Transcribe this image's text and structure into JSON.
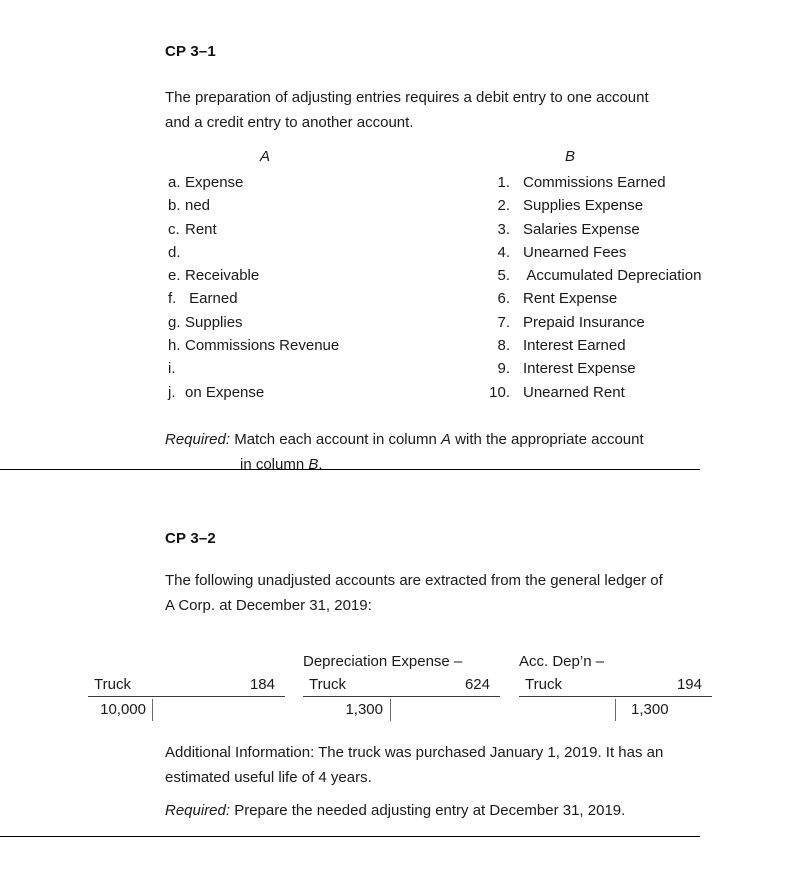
{
  "document": {
    "problems": [
      {
        "id": "cp-3-1",
        "title": "CP 3–1",
        "intro": "The preparation of adjusting entries requires a debit entry to one account and a credit entry to another account.",
        "column_a_header": "A",
        "column_b_header": "B",
        "column_a": [
          {
            "marker": "a.",
            "label": "Expense"
          },
          {
            "marker": "b.",
            "label": "ned"
          },
          {
            "marker": "c.",
            "label": "Rent"
          },
          {
            "marker": "d.",
            "label": ""
          },
          {
            "marker": "e.",
            "label": "Receivable"
          },
          {
            "marker": "f.",
            "label": " Earned"
          },
          {
            "marker": "g.",
            "label": "Supplies"
          },
          {
            "marker": "h.",
            "label": "Commissions Revenue"
          },
          {
            "marker": "i.",
            "label": ""
          },
          {
            "marker": "j.",
            "label": "on Expense"
          }
        ],
        "column_b": [
          {
            "marker": "1.",
            "label": "Commissions Earned"
          },
          {
            "marker": "2.",
            "label": "Supplies Expense"
          },
          {
            "marker": "3.",
            "label": "Salaries Expense"
          },
          {
            "marker": "4.",
            "label": "Unearned Fees"
          },
          {
            "marker": "5.",
            "label": " Accumulated Depreciation"
          },
          {
            "marker": "6.",
            "label": "Rent Expense"
          },
          {
            "marker": "7.",
            "label": "Prepaid Insurance"
          },
          {
            "marker": "8.",
            "label": "Interest Earned"
          },
          {
            "marker": "9.",
            "label": "Interest Expense"
          },
          {
            "marker": "10.",
            "label": "Unearned Rent"
          }
        ],
        "required_label": "Required:",
        "required_line1": " Match each account in column ",
        "required_emph1": "A",
        "required_line1b": " with the appropriate account",
        "required_line2": "in column ",
        "required_emph2": "B",
        "required_line2b": "."
      },
      {
        "id": "cp-3-2",
        "title": "CP 3–2",
        "intro": "The following unadjusted accounts are extracted from the general ledger of A Corp. at December 31, 2019:",
        "t_accounts": [
          {
            "name": "truck",
            "title_line": "",
            "head_left": "Truck",
            "head_right": "184",
            "debit": "10,000",
            "credit": ""
          },
          {
            "name": "depreciation-expense-truck",
            "title_line": "Depreciation Expense –",
            "head_left": "Truck",
            "head_right": "624",
            "debit": "1,300",
            "credit": ""
          },
          {
            "name": "accumulated-depreciation-truck",
            "title_line": "Acc. Dep’n –",
            "head_left": "Truck",
            "head_right": "194",
            "debit": "",
            "credit": "1,300"
          }
        ],
        "additional_info": "Additional Information: The truck was purchased January 1, 2019. It has an estimated useful life of 4 years.",
        "required_label": "Required:",
        "required_text": " Prepare the needed adjusting entry at December 31, 2019."
      }
    ]
  }
}
